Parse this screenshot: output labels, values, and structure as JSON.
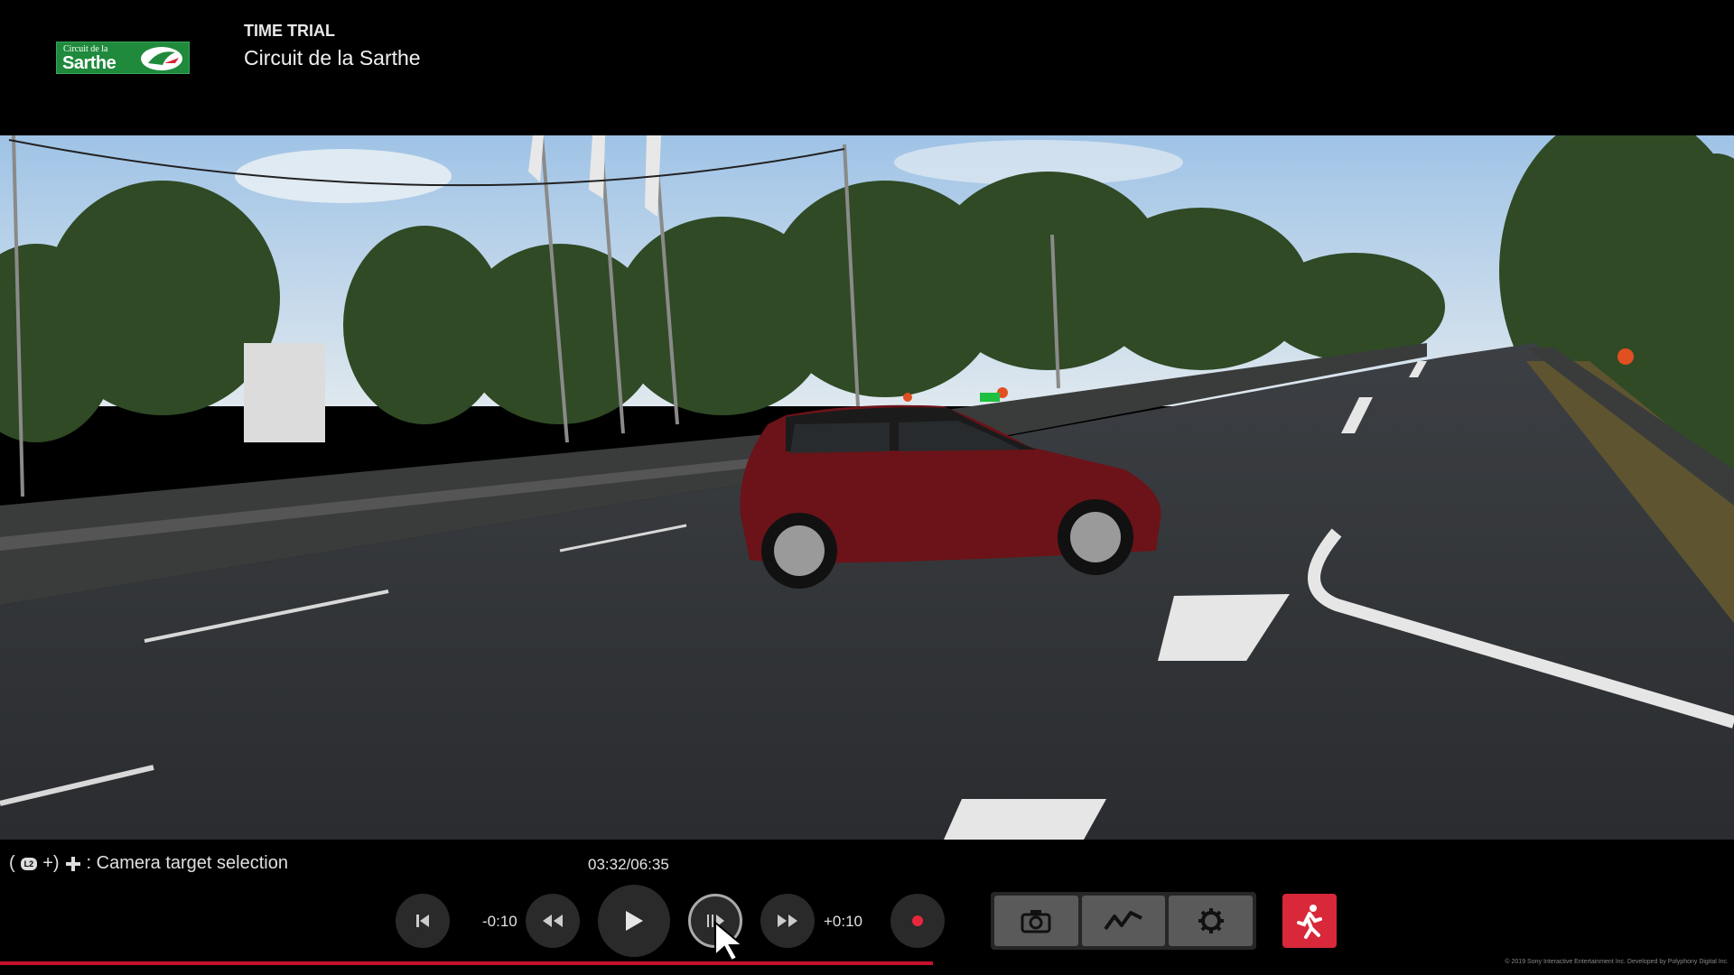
{
  "header": {
    "logo": {
      "small_text": "Circuit de la",
      "big_text": "Sarthe"
    },
    "mode": "TIME TRIAL",
    "track": "Circuit de la Sarthe"
  },
  "hint": {
    "open": "(",
    "plus": "+)",
    "l2": "L2",
    "text": ": Camera target selection"
  },
  "playback": {
    "time": "03:32/06:35",
    "rewind_label": "-0:10",
    "forward_label": "+0:10",
    "progress_fraction": 0.538
  },
  "icons": {
    "skip_back": "skip-to-start-icon",
    "rewind": "rewind-icon",
    "play": "play-icon",
    "slow": "slow-motion-icon",
    "fast_forward": "fast-forward-icon",
    "record": "record-icon",
    "camera": "camera-icon",
    "telemetry": "telemetry-icon",
    "settings": "gear-icon",
    "exit": "exit-runner-icon"
  },
  "colors": {
    "accent_red": "#d8283a",
    "progress": "#c8102e",
    "record": "#e8273c",
    "logo_green": "#1f8a3c"
  },
  "copyright": "© 2019 Sony Interactive Entertainment Inc. Developed by Polyphony Digital Inc."
}
